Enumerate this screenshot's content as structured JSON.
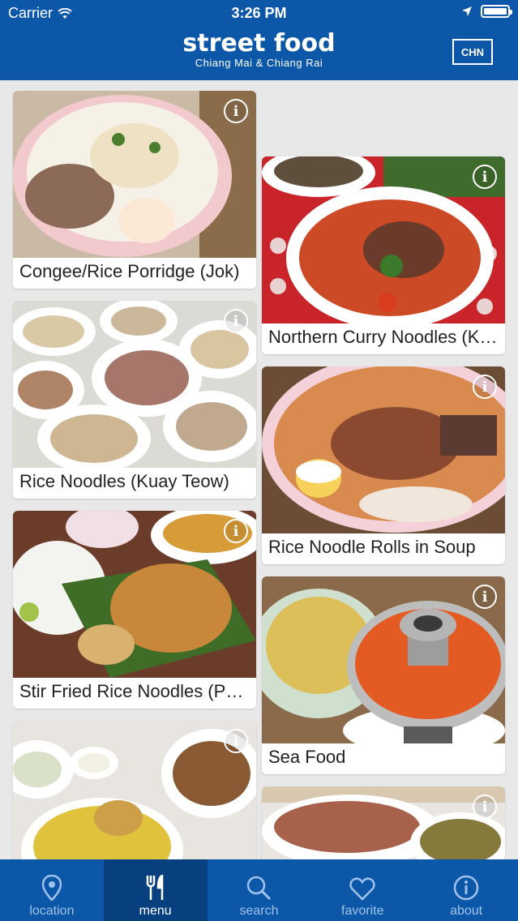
{
  "status": {
    "carrier": "Carrier",
    "time": "3:26 PM"
  },
  "header": {
    "title": "street food",
    "subtitle": "Chiang Mai & Chiang Rai",
    "language_button": "CHN"
  },
  "cards": [
    {
      "label": "Congee/Rice Porridge (Jok)"
    },
    {
      "label": "Rice Noodles (Kuay Teow)"
    },
    {
      "label": "Stir Fried Rice Noodles (Pad Thai)"
    },
    {
      "label": ""
    },
    {
      "label": "Northern Curry Noodles (Khao Soi)"
    },
    {
      "label": "Rice Noodle Rolls in Soup"
    },
    {
      "label": "Sea Food"
    },
    {
      "label": ""
    }
  ],
  "tabs": [
    {
      "label": "location",
      "icon": "location-pin-icon"
    },
    {
      "label": "menu",
      "icon": "fork-knife-icon"
    },
    {
      "label": "search",
      "icon": "search-icon"
    },
    {
      "label": "favorite",
      "icon": "heart-icon"
    },
    {
      "label": "about",
      "icon": "info-icon"
    }
  ],
  "active_tab": "menu",
  "colors": {
    "header": "#0c57a8",
    "tab_active": "#08407f",
    "tab_inactive_text": "#9fc3ea",
    "background": "#e8e8e8"
  }
}
